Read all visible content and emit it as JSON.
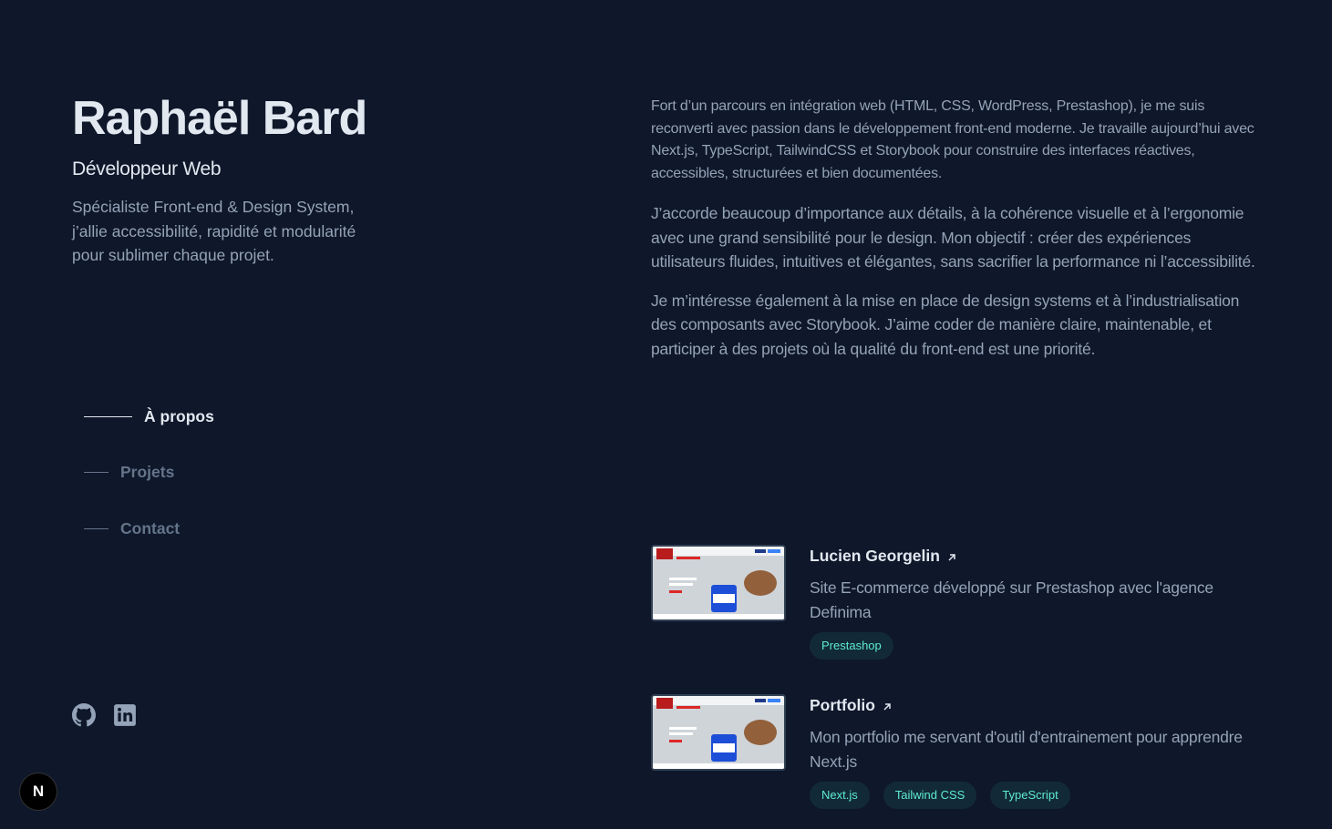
{
  "header": {
    "name": "Raphaël Bard",
    "role": "Développeur Web",
    "tagline": "Spécialiste Front-end & Design System, j’allie accessibilité, rapidité et modularité pour sublimer chaque projet."
  },
  "nav": {
    "items": [
      {
        "label": "À propos",
        "active": true
      },
      {
        "label": "Projets",
        "active": false
      },
      {
        "label": "Contact",
        "active": false
      }
    ]
  },
  "socials": [
    {
      "icon": "github-icon"
    },
    {
      "icon": "linkedin-icon"
    }
  ],
  "next_badge": "N",
  "about": {
    "paragraphs": [
      "Fort d’un parcours en intégration web (HTML, CSS, WordPress, Prestashop), je me suis reconverti avec passion dans le développement front-end moderne. Je travaille aujourd’hui avec Next.js, TypeScript, TailwindCSS et Storybook pour construire des interfaces réactives, accessibles, structurées et bien documentées.",
      "J’accorde beaucoup d’importance aux détails, à la cohérence visuelle et à l’ergonomie avec une grand sensibilité pour le design. Mon objectif : créer des expériences utilisateurs fluides, intuitives et élégantes, sans sacrifier la performance ni l’accessibilité.",
      "Je m’intéresse également à la mise en place de design systems et à l’industrialisation des composants avec Storybook. J’aime coder de manière claire, maintenable, et participer à des projets où la qualité du front-end est une priorité."
    ]
  },
  "projects": [
    {
      "title": "Lucien Georgelin",
      "description": "Site E-commerce développé sur Prestashop avec l'agence Definima",
      "tags": [
        "Prestashop"
      ]
    },
    {
      "title": "Portfolio",
      "description": "Mon portfolio me servant d'outil d'entrainement pour apprendre Next.js",
      "tags": [
        "Next.js",
        "Tailwind CSS",
        "TypeScript"
      ]
    }
  ],
  "colors": {
    "background": "#0f172a",
    "heading": "#e2e8f0",
    "body": "#94a3b8",
    "muted": "#64748b",
    "accent": "#5eead4"
  }
}
